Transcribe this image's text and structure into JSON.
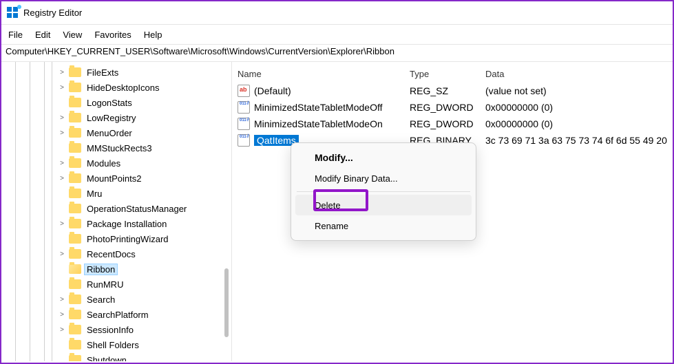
{
  "title": "Registry Editor",
  "menu": {
    "file": "File",
    "edit": "Edit",
    "view": "View",
    "favorites": "Favorites",
    "help": "Help"
  },
  "address": "Computer\\HKEY_CURRENT_USER\\Software\\Microsoft\\Windows\\CurrentVersion\\Explorer\\Ribbon",
  "header": {
    "name": "Name",
    "type": "Type",
    "data": "Data"
  },
  "tree": [
    {
      "label": "FileExts",
      "exp": ">"
    },
    {
      "label": "HideDesktopIcons",
      "exp": ">"
    },
    {
      "label": "LogonStats",
      "exp": ""
    },
    {
      "label": "LowRegistry",
      "exp": ">"
    },
    {
      "label": "MenuOrder",
      "exp": ">"
    },
    {
      "label": "MMStuckRects3",
      "exp": ""
    },
    {
      "label": "Modules",
      "exp": ">"
    },
    {
      "label": "MountPoints2",
      "exp": ">"
    },
    {
      "label": "Mru",
      "exp": ""
    },
    {
      "label": "OperationStatusManager",
      "exp": ""
    },
    {
      "label": "Package Installation",
      "exp": ">"
    },
    {
      "label": "PhotoPrintingWizard",
      "exp": ""
    },
    {
      "label": "RecentDocs",
      "exp": ">"
    },
    {
      "label": "Ribbon",
      "exp": "",
      "sel": true,
      "open": true
    },
    {
      "label": "RunMRU",
      "exp": ""
    },
    {
      "label": "Search",
      "exp": ">"
    },
    {
      "label": "SearchPlatform",
      "exp": ">"
    },
    {
      "label": "SessionInfo",
      "exp": ">"
    },
    {
      "label": "Shell Folders",
      "exp": ""
    },
    {
      "label": "Shutdown",
      "exp": ""
    }
  ],
  "values": [
    {
      "name": "(Default)",
      "type": "REG_SZ",
      "data": "(value not set)",
      "icon": "str"
    },
    {
      "name": "MinimizedStateTabletModeOff",
      "type": "REG_DWORD",
      "data": "0x00000000 (0)",
      "icon": "bin"
    },
    {
      "name": "MinimizedStateTabletModeOn",
      "type": "REG_DWORD",
      "data": "0x00000000 (0)",
      "icon": "bin"
    },
    {
      "name": "QatItems",
      "type": "REG_BINARY",
      "data": "3c 73 69 71 3a 63 75 73 74 6f 6d 55 49 20",
      "icon": "bin",
      "sel": true
    }
  ],
  "ctx": {
    "modify": "Modify...",
    "modifyBin": "Modify Binary Data...",
    "delete": "Delete",
    "rename": "Rename"
  }
}
